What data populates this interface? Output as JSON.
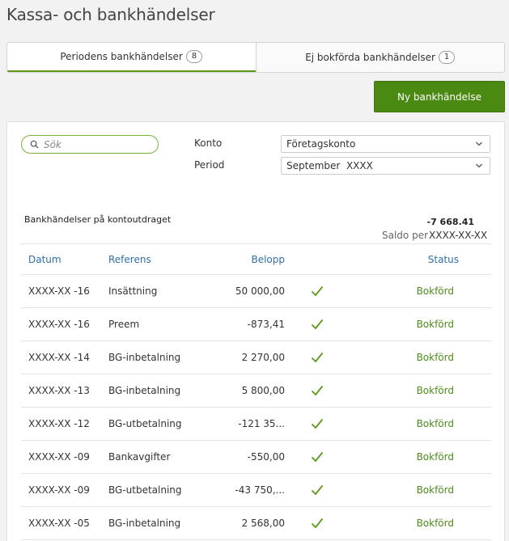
{
  "page": {
    "title": "Kassa- och bankhändelser"
  },
  "tabs": [
    {
      "label": "Periodens bankhändelser",
      "count": "8"
    },
    {
      "label": "Ej bokförda bankhändelser",
      "count": "1"
    }
  ],
  "new_button": {
    "label": "Ny bankhändelse"
  },
  "search": {
    "placeholder": "Sök"
  },
  "filters": {
    "konto_label": "Konto",
    "konto_value": "Företagskonto",
    "period_label": "Period",
    "period_value": "September  XXXX"
  },
  "summary": {
    "title": "Bankhändelser på kontoutdraget",
    "balance": "-7 668.41",
    "balance_label": "Saldo per",
    "balance_date": "XXXX-XX-XX"
  },
  "table": {
    "headers": {
      "date": "Datum",
      "reference": "Referens",
      "amount": "Belopp",
      "status": "Status"
    },
    "rows": [
      {
        "date": "XXXX-XX -16",
        "reference": "Insättning",
        "amount": "50 000,00",
        "status": "Bokförd"
      },
      {
        "date": "XXXX-XX -16",
        "reference": "Preem",
        "amount": "-873,41",
        "status": "Bokförd"
      },
      {
        "date": "XXXX-XX -14",
        "reference": "BG-inbetalning",
        "amount": "2 270,00",
        "status": "Bokförd"
      },
      {
        "date": "XXXX-XX -13",
        "reference": "BG-inbetalning",
        "amount": "5 800,00",
        "status": "Bokförd"
      },
      {
        "date": "XXXX-XX -12",
        "reference": "BG-utbetalning",
        "amount": "-121 35...",
        "status": "Bokförd"
      },
      {
        "date": "XXXX-XX -09",
        "reference": "Bankavgifter",
        "amount": "-550,00",
        "status": "Bokförd"
      },
      {
        "date": "XXXX-XX -09",
        "reference": "BG-utbetalning",
        "amount": "-43 750,...",
        "status": "Bokförd"
      },
      {
        "date": "XXXX-XX -05",
        "reference": "BG-inbetalning",
        "amount": "2 568,00",
        "status": "Bokförd"
      }
    ]
  },
  "icons": {
    "search": "search-icon",
    "chevron": "chevron-down-icon",
    "check": "check-icon"
  },
  "colors": {
    "accent": "#5a9a1a",
    "button": "#4a8a12",
    "status": "#4d8b1b",
    "link": "#2f6fa8"
  }
}
